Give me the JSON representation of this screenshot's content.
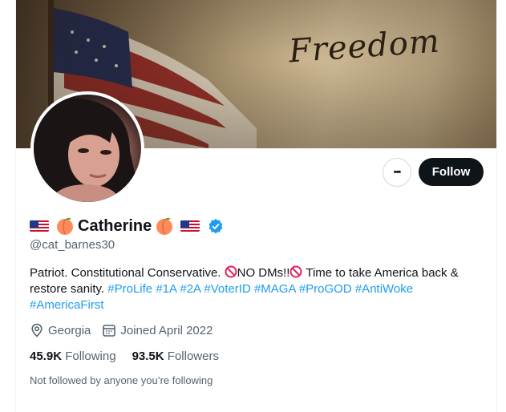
{
  "banner": {
    "text": "Freedom"
  },
  "profile": {
    "name": "Catherine",
    "name_prefix_emoji": "🇺🇸 🍑",
    "name_suffix_emoji": "🍑 🇺🇸",
    "handle": "@cat_barnes30",
    "verified": true,
    "bio_parts": {
      "p1": "Patriot. Constitutional Conservative. ",
      "p2": "NO DMs!!",
      "p3": " Time to take America back & restore sanity. ",
      "tags": [
        "#ProLife",
        "#1A",
        "#2A",
        "#VoterID",
        "#MAGA",
        "#ProGOD",
        "#AntiWoke",
        "#AmericaFirst"
      ]
    },
    "location": "Georgia",
    "joined": "Joined April 2022",
    "following_count": "45.9K",
    "following_label": "Following",
    "followers_count": "93.5K",
    "followers_label": "Followers",
    "not_followed": "Not followed by anyone you’re following"
  },
  "actions": {
    "more_label": "•••",
    "follow_label": "Follow"
  },
  "colors": {
    "accent": "#1d9bf0",
    "text": "#0f1419",
    "muted": "#536471",
    "button": "#0f1419"
  },
  "icons": {
    "verified": "verified-badge-icon",
    "location": "location-pin-icon",
    "calendar": "calendar-icon"
  }
}
